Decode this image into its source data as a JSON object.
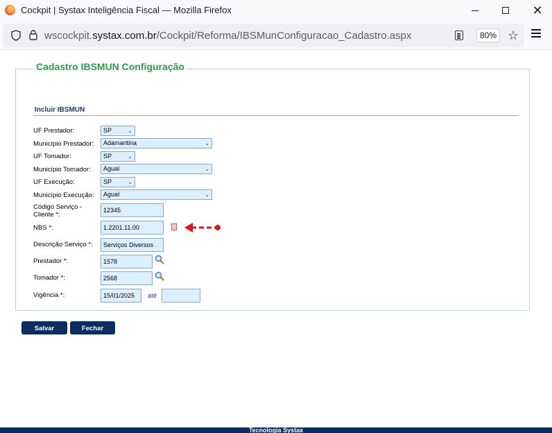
{
  "window": {
    "title": "Cockpit | Systax Inteligência Fiscal — Mozilla Firefox"
  },
  "browser": {
    "url_prefix": "wscockpit.",
    "url_domain": "systax.com.br",
    "url_path": "/Cockpit/Reforma/IBSMunConfiguracao_Cadastro.aspx",
    "zoom": "80%"
  },
  "page": {
    "legend": "Cadastro IBSMUN Configuração",
    "section_title": "Incluir IBSMUN"
  },
  "form": {
    "uf_prestador": {
      "label": "UF Prestador:",
      "value": "SP"
    },
    "municipio_prestador": {
      "label": "Município Prestador:",
      "value": "Adamantina"
    },
    "uf_tomador": {
      "label": "UF Tomador:",
      "value": "SP"
    },
    "municipio_tomador": {
      "label": "Município Tomador:",
      "value": "Aguaí"
    },
    "uf_execucao": {
      "label": "UF Execução:",
      "value": "SP"
    },
    "municipio_execucao": {
      "label": "Município Execução:",
      "value": "Aguaí"
    },
    "codigo_servico": {
      "label_line1": "Código Serviço -",
      "label_line2": "Cliente *:",
      "value": "12345"
    },
    "nbs": {
      "label": "NBS *:",
      "value": "1.2201.11.00"
    },
    "descricao_servico": {
      "label": "Descrição Serviço *:",
      "value": "Serviços Diversos"
    },
    "prestador": {
      "label": "Prestador *:",
      "value": "1578"
    },
    "tomador": {
      "label": "Tomador *:",
      "value": "2568"
    },
    "vigencia": {
      "label": "Vigência *:",
      "start": "15/01/2025",
      "separator": "até",
      "end": ""
    }
  },
  "buttons": {
    "save": "Salvar",
    "close": "Fechar"
  },
  "footer": {
    "text": "Tecnologia Systax"
  },
  "colors": {
    "legend_green": "#2a9d49",
    "button_navy": "#0b2d5f",
    "field_bg": "#dcefff",
    "arrow_red": "#d9141b"
  }
}
